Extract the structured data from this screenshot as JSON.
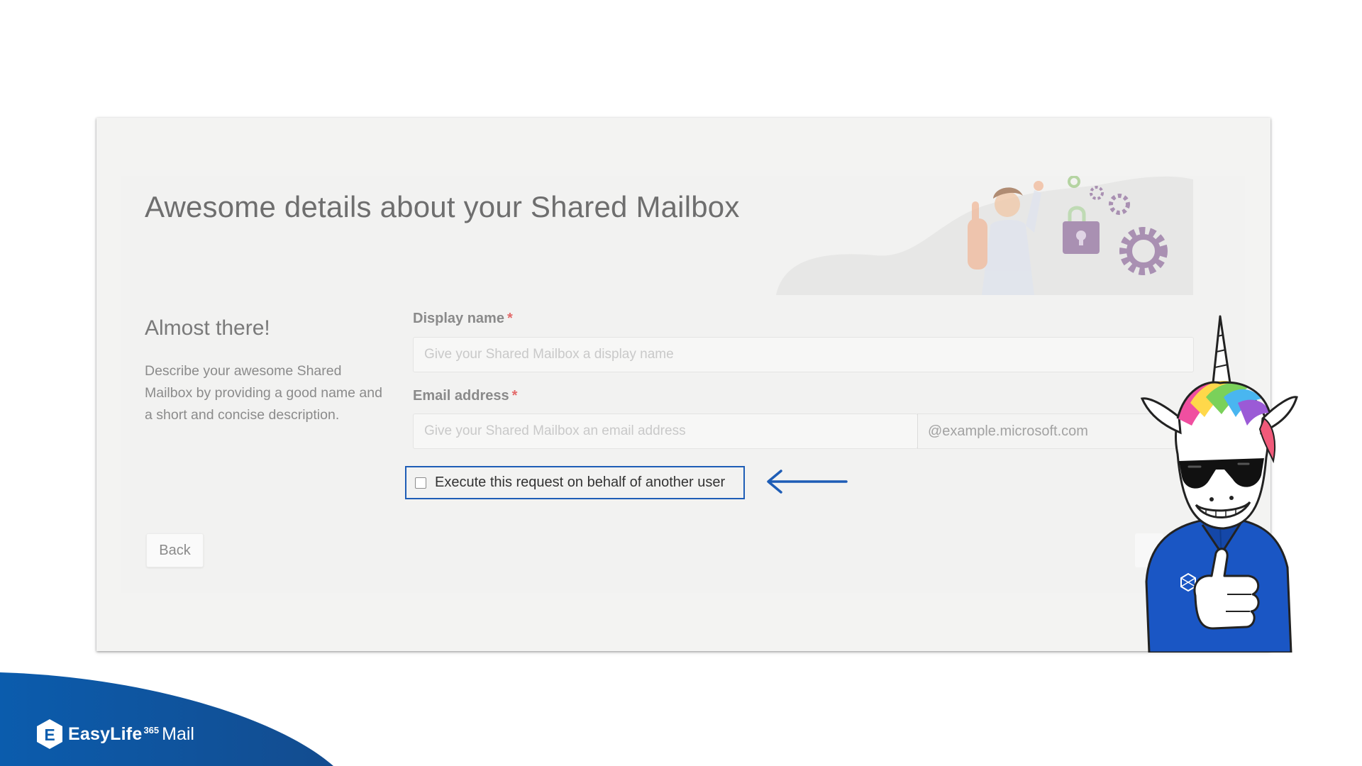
{
  "page": {
    "title": "Awesome details about your Shared Mailbox"
  },
  "intro": {
    "heading": "Almost there!",
    "description": "Describe your awesome Shared Mailbox by providing a good name and a short and concise description."
  },
  "form": {
    "display_name": {
      "label": "Display name",
      "required_mark": "*",
      "placeholder": "Give your Shared Mailbox a display name",
      "value": ""
    },
    "email": {
      "label": "Email address",
      "required_mark": "*",
      "placeholder": "Give your Shared Mailbox an email address",
      "value": "",
      "domain_suffix": "@example.microsoft.com"
    },
    "behalf_checkbox": {
      "label": "Execute this request on behalf of another user",
      "checked": false
    }
  },
  "buttons": {
    "back": "Back"
  },
  "brand": {
    "logo_letter": "E",
    "name": "EasyLife",
    "superscript": "365",
    "product": "Mail"
  },
  "colors": {
    "accent": "#1e5db6",
    "required": "#e36a6a",
    "brand_blue": "#0b5cad"
  },
  "icons": {
    "arrow": "arrow-left-icon",
    "logo": "easylife-hex-logo-icon"
  }
}
